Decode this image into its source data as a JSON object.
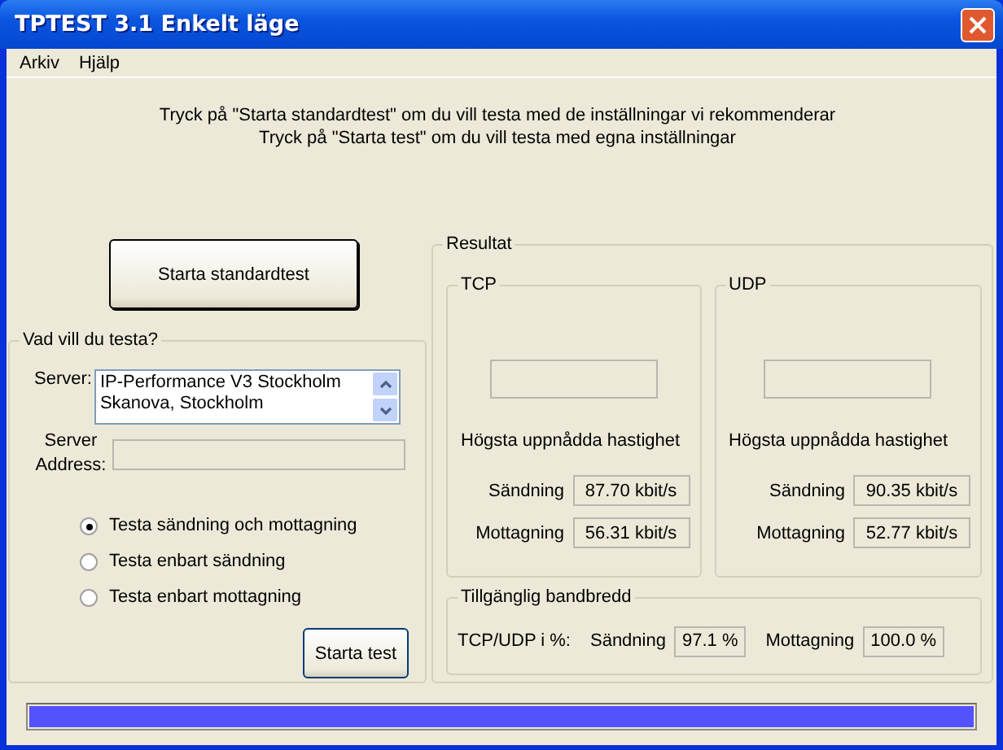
{
  "window": {
    "title": "TPTEST 3.1 Enkelt läge"
  },
  "menu": [
    "Arkiv",
    "Hjälp"
  ],
  "instructions": [
    "Tryck på \"Starta standardtest\" om du vill testa med de inställningar vi rekommenderar",
    "Tryck på \"Starta test\" om du vill testa med egna inställningar"
  ],
  "standard_button": "Starta standardtest",
  "test_group": {
    "title": "Vad vill du testa?",
    "server_label": "Server:",
    "servers": [
      "IP-Performance V3 Stockholm",
      "Skanova, Stockholm"
    ],
    "address_label": "Server Address:",
    "options": [
      {
        "label": "Testa sändning och mottagning",
        "selected": true
      },
      {
        "label": "Testa enbart sändning",
        "selected": false
      },
      {
        "label": "Testa enbart mottagning",
        "selected": false
      }
    ],
    "start_button": "Starta test"
  },
  "results": {
    "title": "Resultat",
    "protocols": [
      {
        "name": "TCP",
        "heading": "Högsta uppnådda hastighet",
        "rows": [
          {
            "label": "Sändning",
            "value": "87.70 kbit/s"
          },
          {
            "label": "Mottagning",
            "value": "56.31 kbit/s"
          }
        ]
      },
      {
        "name": "UDP",
        "heading": "Högsta uppnådda hastighet",
        "rows": [
          {
            "label": "Sändning",
            "value": "90.35 kbit/s"
          },
          {
            "label": "Mottagning",
            "value": "52.77 kbit/s"
          }
        ]
      }
    ],
    "bandwidth": {
      "title": "Tillgänglig bandbredd",
      "label": "TCP/UDP i %:",
      "rows": [
        {
          "label": "Sändning",
          "value": "97.1 %"
        },
        {
          "label": "Mottagning",
          "value": "100.0 %"
        }
      ]
    }
  },
  "progress": {
    "level": 1
  }
}
